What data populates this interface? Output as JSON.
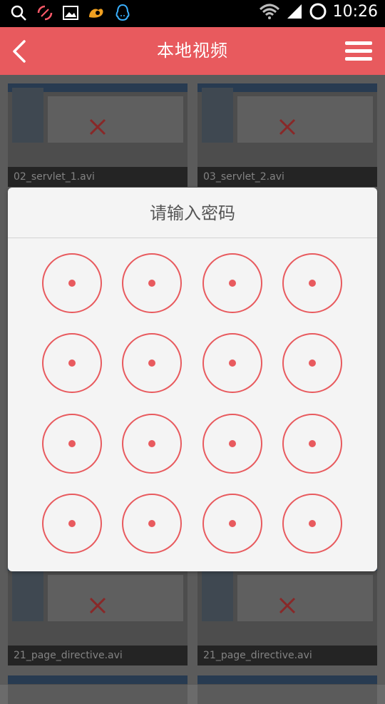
{
  "status_bar": {
    "time": "10:26",
    "icons_left": [
      "search-icon",
      "broken-link-icon",
      "image-icon",
      "uc-browser-icon",
      "qq-icon"
    ],
    "icons_right": [
      "wifi-icon",
      "signal-icon",
      "battery-ring-icon"
    ]
  },
  "header": {
    "title": "本地视频",
    "background": "#e85a5e"
  },
  "videos": [
    {
      "name": "02_servlet_1.avi"
    },
    {
      "name": "03_servlet_2.avi"
    },
    {
      "name": "21_page_directive.avi"
    },
    {
      "name": "21_page_directive.avi"
    }
  ],
  "dialog": {
    "title": "请输入密码",
    "keys": 16,
    "accent": "#e85a5e"
  }
}
